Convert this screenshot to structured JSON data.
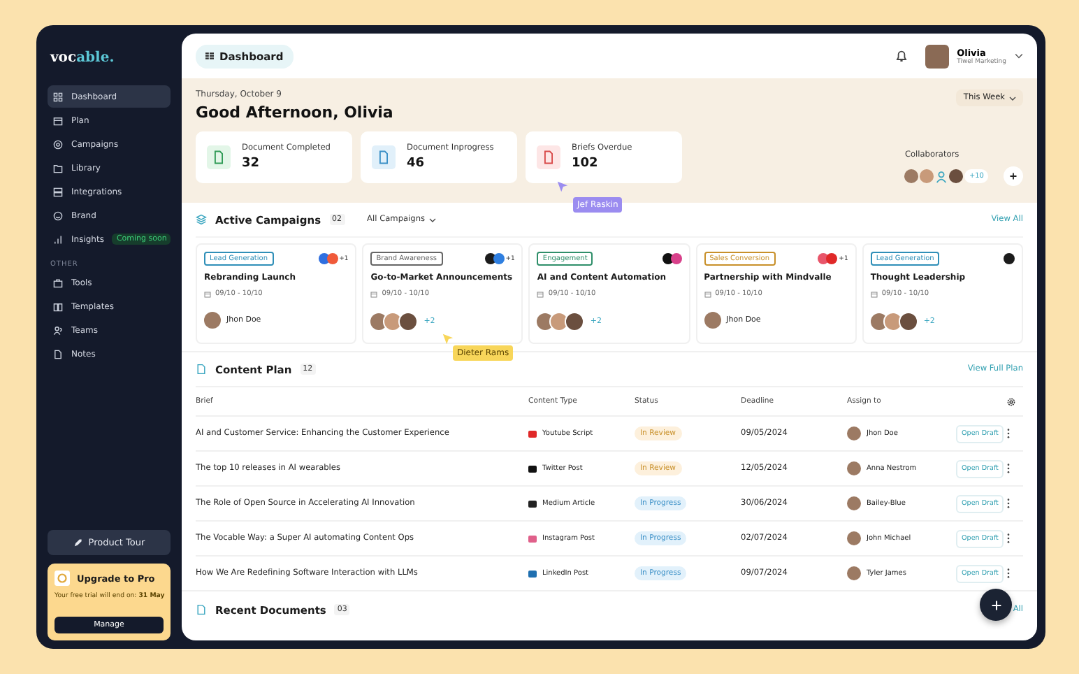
{
  "sidebar": {
    "logo_parts": [
      "voc",
      "able."
    ],
    "items": [
      {
        "label": "Dashboard",
        "selected": true
      },
      {
        "label": "Plan",
        "selected": false
      },
      {
        "label": "Campaigns",
        "selected": false
      },
      {
        "label": "Library",
        "selected": false
      },
      {
        "label": "Integrations",
        "selected": false
      },
      {
        "label": "Brand",
        "selected": false
      },
      {
        "label": "Insights",
        "selected": false,
        "badge": "Coming soon"
      }
    ],
    "section_label": "OTHER",
    "other_items": [
      {
        "label": "Tools",
        "selected": false
      },
      {
        "label": "Templates",
        "selected": false
      },
      {
        "label": "Teams",
        "selected": false
      },
      {
        "label": "Notes",
        "selected": false
      }
    ],
    "product_tour": "Product Tour",
    "upgrade": {
      "title": "Upgrade to Pro",
      "text": "Your free trial will end on: **31 May**",
      "button": "Manage"
    }
  },
  "header": {
    "breadcrumb": "Dashboard",
    "user_name": "Olivia",
    "user_role": "Tiwel Marketing"
  },
  "hero": {
    "date": "Thursday, October 9",
    "greeting": "Good Afternoon, Olivia",
    "period": "This Week",
    "stats": [
      {
        "label": "Document Completed",
        "value": "32",
        "kind": "completed"
      },
      {
        "label": "Document Inprogress",
        "value": "46",
        "kind": "progress"
      },
      {
        "label": "Briefs Overdue",
        "value": "102",
        "kind": "overdue"
      }
    ],
    "collaborators_label": "Collaborators",
    "collaborators_more": "+10"
  },
  "campaigns": {
    "title": "Active Campaigns",
    "count": "02",
    "filter": "All Campaigns",
    "view_all": "View All",
    "cards": [
      {
        "tag": "Lead Generation",
        "color": "#2f8fb8",
        "platforms": [
          {
            "color": "#2f6fe0"
          },
          {
            "color": "#f05a3a"
          }
        ],
        "platforms_more": "+1",
        "title": "Rebranding Launch",
        "dates": "09/10 - 10/10",
        "owner": "Jhon Doe"
      },
      {
        "tag": "Brand Awareness",
        "color": "#666666",
        "platforms": [
          {
            "color": "#1b1b1b"
          },
          {
            "color": "#2f7fe0"
          }
        ],
        "platforms_more": "+1",
        "title": "Go-to-Market Announcements",
        "dates": "09/10 - 10/10",
        "avatars_more": "+2"
      },
      {
        "tag": "Engagement",
        "color": "#2f8f6a",
        "platforms": [
          {
            "color": "#111111"
          },
          {
            "color": "#d8408a"
          }
        ],
        "title": "AI and Content Automation",
        "dates": "09/10 - 10/10",
        "avatars_more": "+2"
      },
      {
        "tag": "Sales Conversion",
        "color": "#c8902a",
        "platforms": [
          {
            "color": "#e8556a"
          },
          {
            "color": "#e02828"
          }
        ],
        "platforms_more": "+1",
        "title": "Partnership with Mindvalle",
        "dates": "09/10 - 10/10",
        "owner": "Jhon Doe"
      },
      {
        "tag": "Lead Generation",
        "color": "#2f8fb8",
        "platforms": [
          {
            "color": "#1b1b1b"
          }
        ],
        "title": "Thought Leadership",
        "dates": "09/10 - 10/10",
        "avatars_more": "+2"
      }
    ]
  },
  "content_plan": {
    "title": "Content Plan",
    "count": "12",
    "view_all": "View Full Plan",
    "columns": [
      "Brief",
      "Content Type",
      "Status",
      "Deadline",
      "Assign to"
    ],
    "rows": [
      {
        "brief": "AI and Customer Service: Enhancing the Customer Experience",
        "type": "Youtube Script",
        "color": "#e02828",
        "status": "In Review",
        "kind": "review",
        "deadline": "09/05/2024",
        "assignee": "Jhon Doe",
        "action": "Open Draft"
      },
      {
        "brief": "The top 10 releases in AI wearables",
        "type": "Twitter Post",
        "color": "#111111",
        "status": "In Review",
        "kind": "review",
        "deadline": "12/05/2024",
        "assignee": "Anna Nestrom",
        "action": "Open Draft"
      },
      {
        "brief": "The Role of Open Source in Accelerating AI Innovation",
        "type": "Medium Article",
        "color": "#222222",
        "status": "In Progress",
        "kind": "progress",
        "deadline": "30/06/2024",
        "assignee": "Bailey-Blue",
        "action": "Open Draft"
      },
      {
        "brief": "The Vocable Way: a Super AI automating Content Ops",
        "type": "Instagram Post",
        "color": "#e0608a",
        "status": "In Progress",
        "kind": "progress",
        "deadline": "02/07/2024",
        "assignee": "John Michael",
        "action": "Open Draft"
      },
      {
        "brief": "How We Are Redefining Software Interaction with LLMs",
        "type": "LinkedIn Post",
        "color": "#1f6fb0",
        "status": "In Progress",
        "kind": "progress",
        "deadline": "09/07/2024",
        "assignee": "Tyler James",
        "action": "Open Draft"
      }
    ]
  },
  "recent_documents": {
    "title": "Recent Documents",
    "count": "03",
    "view_all": "All"
  },
  "tooltips": [
    {
      "text": "Jef Raskin",
      "kind": "purple"
    },
    {
      "text": "Dieter Rams",
      "kind": "yellow"
    }
  ]
}
